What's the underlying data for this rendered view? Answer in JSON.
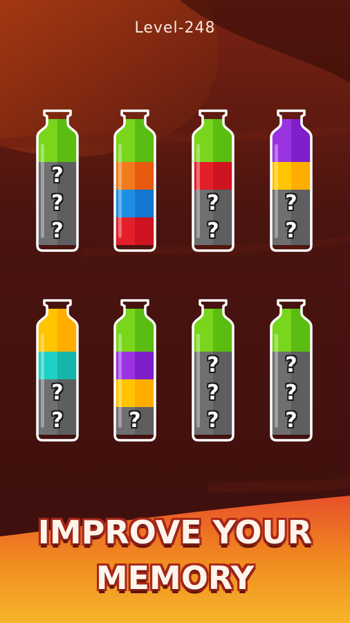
{
  "level": {
    "label": "Level-248"
  },
  "banner": {
    "line1": "IMPROVE YOUR",
    "line2": "MEMORY"
  },
  "colors": {
    "background": "#3a0f0e",
    "green": "#79d61c",
    "orange": "#f07b1c",
    "blue": "#1e8ee3",
    "red": "#e31f2a",
    "purple": "#9a34e3",
    "yellow": "#ffc400",
    "cyan": "#1fd0c4",
    "hidden": "#6f6f71"
  },
  "bottles": [
    {
      "layers": [
        "green",
        "hidden",
        "hidden",
        "hidden"
      ]
    },
    {
      "layers": [
        "green",
        "orange",
        "blue",
        "red"
      ]
    },
    {
      "layers": [
        "green",
        "red",
        "hidden",
        "hidden"
      ]
    },
    {
      "layers": [
        "purple",
        "yellow",
        "hidden",
        "hidden"
      ]
    },
    {
      "layers": [
        "yellow",
        "cyan",
        "hidden",
        "hidden"
      ]
    },
    {
      "layers": [
        "green",
        "purple",
        "yellow",
        "hidden"
      ]
    },
    {
      "layers": [
        "green",
        "hidden",
        "hidden",
        "hidden"
      ]
    },
    {
      "layers": [
        "green",
        "hidden",
        "hidden",
        "hidden"
      ]
    }
  ],
  "hidden_symbol": "?"
}
